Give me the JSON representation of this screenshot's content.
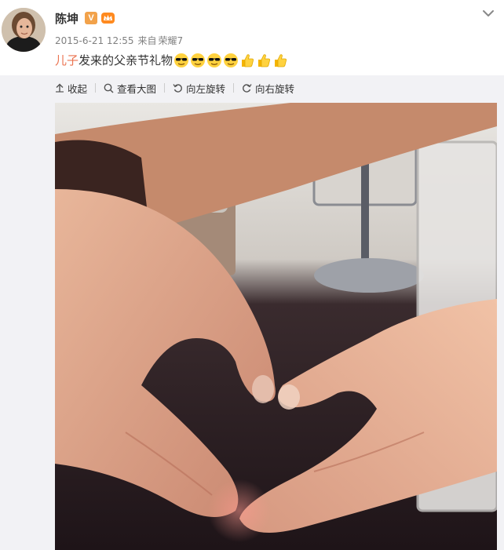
{
  "post": {
    "author": "陈坤",
    "vip_badge": "V",
    "timestamp": "2015-6-21 12:55",
    "from_label": "来自",
    "client": "荣耀7",
    "text_mention": "儿子",
    "text_body": "发来的父亲节礼物",
    "emojis": [
      "cool-emoji",
      "cool-emoji",
      "cool-emoji",
      "cool-emoji",
      "thumbs-up-emoji",
      "thumbs-up-emoji",
      "thumbs-up-emoji"
    ]
  },
  "toolbar": {
    "collapse_label": "收起",
    "view_large_label": "查看大图",
    "rotate_left_label": "向左旋转",
    "rotate_right_label": "向右旋转"
  },
  "colors": {
    "mention": "#eb7350",
    "meta_text": "#808080",
    "toolbar_bg": "#f2f2f5",
    "vip_badge": "#f2a24a"
  }
}
